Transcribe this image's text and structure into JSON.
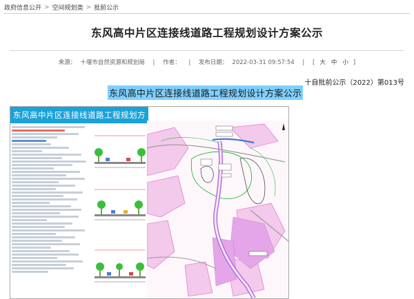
{
  "breadcrumb": {
    "items": [
      "政府信息公开",
      "空间规划类",
      "批前公示"
    ],
    "separator": ">"
  },
  "article": {
    "title": "东风高中片区连接线道路工程规划设计方案公示",
    "source_label": "来源：",
    "source_value": "十堰市自然资源和规划局",
    "author_label": "作者：",
    "date_label": "发布日期：",
    "date_value": "2022-03-31 09:57:54",
    "size_open": "[",
    "size_large": "大",
    "size_medium": "中",
    "size_small": "小",
    "size_close": "]",
    "doc_number": "十自批前公示（2022）第013号",
    "heading": "东风高中片区连接线道路工程规划设计方案公示"
  },
  "poster": {
    "title": "东风高中片区连接线道路工程规划方案公示"
  },
  "colors": {
    "poster_banner": "#1aa2d9",
    "heading_highlight": "#7fd0ff",
    "road_purple": "#b070d8",
    "plot_pink": "#e060c0",
    "green_line": "#22bb33"
  }
}
